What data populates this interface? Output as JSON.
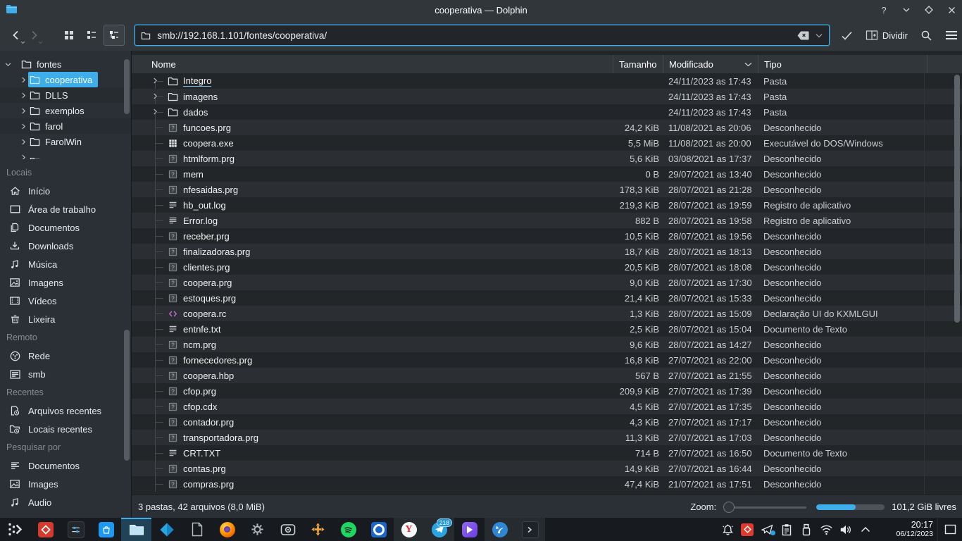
{
  "titlebar": {
    "title": "cooperativa — Dolphin",
    "controls": [
      "help",
      "minimize",
      "maximize",
      "close"
    ]
  },
  "toolbar": {
    "url": "smb://192.168.1.101/fontes/cooperativa/",
    "split_label": "Dividir"
  },
  "sidebar": {
    "tree": {
      "root": "fontes",
      "children": [
        "cooperativa",
        "DLLS",
        "exemplos",
        "farol",
        "FarolWin"
      ],
      "selected": "cooperativa"
    },
    "sections": [
      {
        "label": "Locais",
        "items": [
          {
            "label": "Início",
            "icon": "home-icon"
          },
          {
            "label": "Área de trabalho",
            "icon": "desktop-icon"
          },
          {
            "label": "Documentos",
            "icon": "documents-icon"
          },
          {
            "label": "Downloads",
            "icon": "downloads-icon"
          },
          {
            "label": "Música",
            "icon": "music-icon"
          },
          {
            "label": "Imagens",
            "icon": "image-icon"
          },
          {
            "label": "Vídeos",
            "icon": "video-icon"
          },
          {
            "label": "Lixeira",
            "icon": "trash-icon"
          }
        ]
      },
      {
        "label": "Remoto",
        "items": [
          {
            "label": "Rede",
            "icon": "network-icon"
          },
          {
            "label": "smb",
            "icon": "server-icon"
          }
        ]
      },
      {
        "label": "Recentes",
        "items": [
          {
            "label": "Arquivos recentes",
            "icon": "recent-file-icon"
          },
          {
            "label": "Locais recentes",
            "icon": "recent-folder-icon"
          }
        ]
      },
      {
        "label": "Pesquisar por",
        "items": [
          {
            "label": "Documentos",
            "icon": "doc-lines-icon"
          },
          {
            "label": "Images",
            "icon": "image-icon"
          },
          {
            "label": "Audio",
            "icon": "music-icon"
          }
        ]
      }
    ]
  },
  "table": {
    "headers": {
      "name": "Nome",
      "size": "Tamanho",
      "modified": "Modificado",
      "type": "Tipo"
    },
    "rows": [
      {
        "name": "Integro",
        "icon": "folder-icon",
        "folder": true,
        "hovered": true,
        "size": "",
        "modified": "24/11/2023 as 17:43",
        "type": "Pasta"
      },
      {
        "name": "imagens",
        "icon": "folder-icon",
        "folder": true,
        "size": "",
        "modified": "24/11/2023 as 17:43",
        "type": "Pasta"
      },
      {
        "name": "dados",
        "icon": "folder-icon",
        "folder": true,
        "size": "",
        "modified": "24/11/2023 as 17:43",
        "type": "Pasta"
      },
      {
        "name": "funcoes.prg",
        "icon": "unknown-file-icon",
        "size": "24,2 KiB",
        "modified": "11/08/2021 as 20:06",
        "type": "Desconhecido"
      },
      {
        "name": "coopera.exe",
        "icon": "exe-file-icon",
        "size": "5,5 MiB",
        "modified": "11/08/2021 as 20:00",
        "type": "Executável do DOS/Windows"
      },
      {
        "name": "htmlform.prg",
        "icon": "unknown-file-icon",
        "size": "5,6 KiB",
        "modified": "03/08/2021 as 17:37",
        "type": "Desconhecido"
      },
      {
        "name": "mem",
        "icon": "unknown-file-icon",
        "size": "0 B",
        "modified": "29/07/2021 as 13:40",
        "type": "Desconhecido"
      },
      {
        "name": "nfesaidas.prg",
        "icon": "unknown-file-icon",
        "size": "178,3 KiB",
        "modified": "28/07/2021 as 21:28",
        "type": "Desconhecido"
      },
      {
        "name": "hb_out.log",
        "icon": "text-file-icon",
        "size": "219,3 KiB",
        "modified": "28/07/2021 as 19:59",
        "type": "Registro de aplicativo"
      },
      {
        "name": "Error.log",
        "icon": "text-file-icon",
        "size": "882 B",
        "modified": "28/07/2021 as 19:58",
        "type": "Registro de aplicativo"
      },
      {
        "name": "receber.prg",
        "icon": "unknown-file-icon",
        "size": "10,5 KiB",
        "modified": "28/07/2021 as 19:56",
        "type": "Desconhecido"
      },
      {
        "name": "finalizadoras.prg",
        "icon": "unknown-file-icon",
        "size": "18,7 KiB",
        "modified": "28/07/2021 as 18:13",
        "type": "Desconhecido"
      },
      {
        "name": "clientes.prg",
        "icon": "unknown-file-icon",
        "size": "20,5 KiB",
        "modified": "28/07/2021 as 18:08",
        "type": "Desconhecido"
      },
      {
        "name": "coopera.prg",
        "icon": "unknown-file-icon",
        "size": "9,0 KiB",
        "modified": "28/07/2021 as 17:30",
        "type": "Desconhecido"
      },
      {
        "name": "estoques.prg",
        "icon": "unknown-file-icon",
        "size": "21,4 KiB",
        "modified": "28/07/2021 as 15:33",
        "type": "Desconhecido"
      },
      {
        "name": "coopera.rc",
        "icon": "code-file-icon",
        "size": "1,3 KiB",
        "modified": "28/07/2021 as 15:09",
        "type": "Declaração UI do KXMLGUI"
      },
      {
        "name": "entnfe.txt",
        "icon": "text-file-icon",
        "size": "2,5 KiB",
        "modified": "28/07/2021 as 15:04",
        "type": "Documento de Texto"
      },
      {
        "name": "ncm.prg",
        "icon": "unknown-file-icon",
        "size": "9,6 KiB",
        "modified": "28/07/2021 as 14:27",
        "type": "Desconhecido"
      },
      {
        "name": "fornecedores.prg",
        "icon": "unknown-file-icon",
        "size": "16,8 KiB",
        "modified": "27/07/2021 as 22:00",
        "type": "Desconhecido"
      },
      {
        "name": "coopera.hbp",
        "icon": "unknown-file-icon",
        "size": "567 B",
        "modified": "27/07/2021 as 21:55",
        "type": "Desconhecido"
      },
      {
        "name": "cfop.prg",
        "icon": "unknown-file-icon",
        "size": "209,9 KiB",
        "modified": "27/07/2021 as 17:39",
        "type": "Desconhecido"
      },
      {
        "name": "cfop.cdx",
        "icon": "unknown-file-icon",
        "size": "4,5 KiB",
        "modified": "27/07/2021 as 17:35",
        "type": "Desconhecido"
      },
      {
        "name": "contador.prg",
        "icon": "unknown-file-icon",
        "size": "4,3 KiB",
        "modified": "27/07/2021 as 17:17",
        "type": "Desconhecido"
      },
      {
        "name": "transportadora.prg",
        "icon": "unknown-file-icon",
        "size": "11,3 KiB",
        "modified": "27/07/2021 as 17:03",
        "type": "Desconhecido"
      },
      {
        "name": "CRT.TXT",
        "icon": "text-file-icon",
        "size": "714 B",
        "modified": "27/07/2021 as 16:50",
        "type": "Documento de Texto"
      },
      {
        "name": "contas.prg",
        "icon": "unknown-file-icon",
        "size": "14,9 KiB",
        "modified": "27/07/2021 as 16:44",
        "type": "Desconhecido"
      },
      {
        "name": "compras.prg",
        "icon": "unknown-file-icon",
        "size": "47,4 KiB",
        "modified": "21/07/2021 as 17:51",
        "type": "Desconhecido"
      }
    ]
  },
  "statusbar": {
    "summary": "3 pastas, 42 arquivos (8,0 MiB)",
    "zoom_label": "Zoom:",
    "free_space": "101,2 GiB livres"
  },
  "taskbar": {
    "apps": [
      {
        "name": "app-launcher",
        "icon": "launcher-icon"
      },
      {
        "name": "anydesk",
        "icon": "anydesk-icon"
      },
      {
        "name": "tweaks",
        "icon": "sliders-icon"
      },
      {
        "name": "discover",
        "icon": "discover-icon"
      },
      {
        "name": "dolphin",
        "icon": "dolphin-icon",
        "open": true,
        "active": true
      },
      {
        "name": "kodi",
        "icon": "kodi-icon"
      },
      {
        "name": "text-document",
        "icon": "document-icon"
      },
      {
        "name": "firefox",
        "icon": "firefox-icon"
      },
      {
        "name": "gear-app",
        "icon": "gear-icon"
      },
      {
        "name": "webcam-app",
        "icon": "webcam-icon"
      },
      {
        "name": "move-arrows-app",
        "icon": "orange-arrows-icon"
      },
      {
        "name": "spotify",
        "icon": "spotify-icon"
      },
      {
        "name": "o-ring-app",
        "icon": "o-ring-icon"
      },
      {
        "name": "yandex-browser",
        "icon": "yandex-icon",
        "open": true
      },
      {
        "name": "telegram",
        "icon": "telegram-icon",
        "open": true,
        "badge": "218"
      },
      {
        "name": "purple-player",
        "icon": "purple-play-icon"
      },
      {
        "name": "blue-k-app",
        "icon": "blue-k-icon",
        "open": true
      },
      {
        "name": "terminal",
        "icon": "terminal-icon",
        "open": true
      }
    ],
    "tray": [
      {
        "icon": "notifications-bell-icon"
      },
      {
        "icon": "anydesk-tray-icon"
      },
      {
        "icon": "telegram-tray-icon"
      },
      {
        "icon": "clipboard-icon"
      },
      {
        "icon": "usb-device-icon"
      },
      {
        "icon": "wifi-icon"
      },
      {
        "icon": "volume-icon"
      },
      {
        "icon": "expand-tray-icon"
      }
    ],
    "clock": {
      "time": "20:17",
      "date": "06/12/2023"
    }
  }
}
